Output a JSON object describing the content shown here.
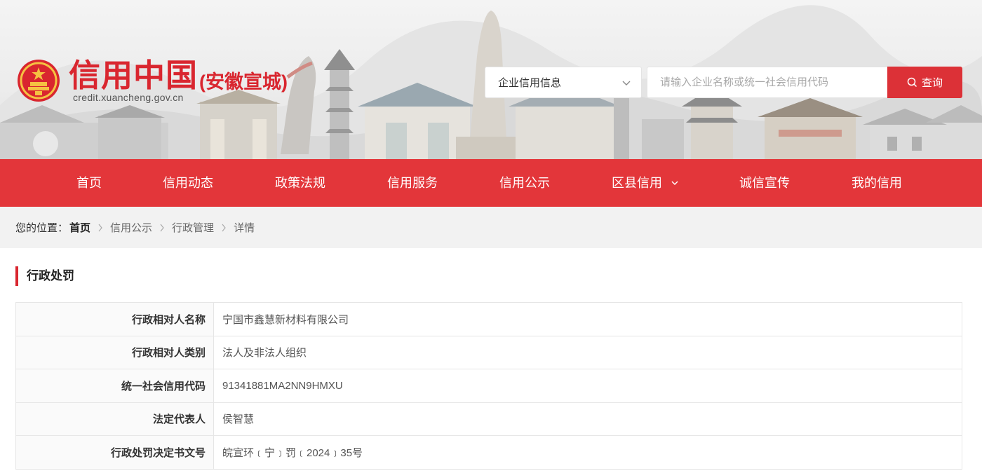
{
  "header": {
    "title": "信用中国",
    "region": "(安徽宣城)",
    "url": "credit.xuancheng.gov.cn",
    "emblem_icon": "national-emblem-icon"
  },
  "search": {
    "category": "企业信用信息",
    "placeholder": "请输入企业名称或统一社会信用代码",
    "button_label": "查询"
  },
  "nav": {
    "items": [
      {
        "label": "首页"
      },
      {
        "label": "信用动态"
      },
      {
        "label": "政策法规"
      },
      {
        "label": "信用服务"
      },
      {
        "label": "信用公示"
      },
      {
        "label": "区县信用"
      },
      {
        "label": "诚信宣传"
      },
      {
        "label": "我的信用"
      }
    ]
  },
  "breadcrumb": {
    "lead": "您的位置：",
    "items": [
      "首页",
      "信用公示",
      "行政管理",
      "详情"
    ]
  },
  "section": {
    "title": "行政处罚"
  },
  "detail": {
    "rows": [
      {
        "label": "行政相对人名称",
        "value": "宁国市鑫慧新材料有限公司"
      },
      {
        "label": "行政相对人类别",
        "value": "法人及非法人组织"
      },
      {
        "label": "统一社会信用代码",
        "value": "91341881MA2NN9HMXU"
      },
      {
        "label": "法定代表人",
        "value": "侯智慧"
      },
      {
        "label": "行政处罚决定书文号",
        "value": "皖宣环﹝宁﹞罚﹝2024﹞35号"
      }
    ]
  },
  "colors": {
    "brand_red": "#d9262f",
    "nav_red": "#e3363a",
    "button_red": "#dc3137"
  }
}
